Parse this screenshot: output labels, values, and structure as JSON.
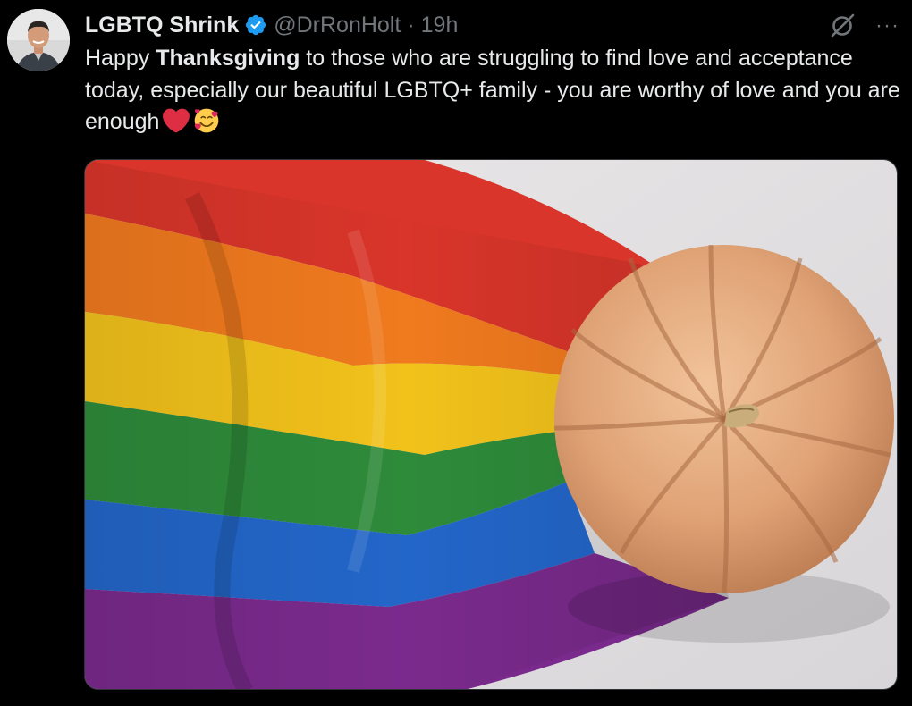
{
  "tweet": {
    "author": {
      "display_name": "LGBTQ Shrink",
      "handle": "@DrRonHolt",
      "verified": true,
      "avatar_icon": "profile-photo"
    },
    "separator": "·",
    "timestamp": "19h",
    "text": {
      "part1": "Happy ",
      "bold": "Thanksgiving",
      "part2": " to those who are struggling to find love and acceptance today, especially our beautiful LGBTQ+ family - you are worthy of love and you are enough"
    },
    "emojis": [
      "red-heart",
      "smiling-face-with-hearts"
    ],
    "actions": {
      "grok_icon": "grok-icon",
      "more_icon": "more-options-icon",
      "more_glyph": "···"
    },
    "media": {
      "type": "photo",
      "content": "rainbow-pride-flag-with-pumpkin"
    }
  },
  "colors": {
    "background": "#000000",
    "text_primary": "#e7e9ea",
    "text_secondary": "#71767b",
    "verified_blue": "#1d9bf0",
    "border": "#2f3336"
  }
}
